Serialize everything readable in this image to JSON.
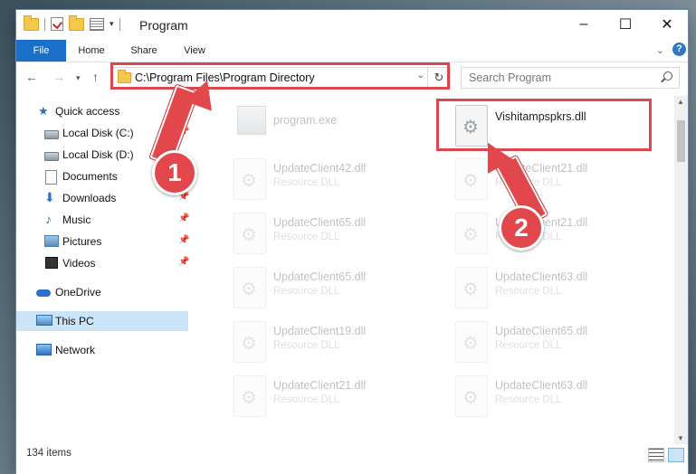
{
  "window": {
    "title": "Program",
    "controls": {
      "minimize": "–",
      "maximize": "☐",
      "close": "✕"
    }
  },
  "ribbon": {
    "tabs": [
      "File",
      "Home",
      "Share",
      "View"
    ]
  },
  "navigation": {
    "address": "C:\\Program Files\\Program Directory",
    "search_placeholder": "Search Program"
  },
  "sidebar": {
    "items": [
      {
        "label": "Quick access",
        "icon": "star-icon"
      },
      {
        "label": "Local Disk (C:)",
        "icon": "drive-icon",
        "pinned": true
      },
      {
        "label": "Local Disk (D:)",
        "icon": "drive-icon"
      },
      {
        "label": "Documents",
        "icon": "documents-icon",
        "pinned": true
      },
      {
        "label": "Downloads",
        "icon": "downloads-icon",
        "pinned": true
      },
      {
        "label": "Music",
        "icon": "music-icon",
        "pinned": true
      },
      {
        "label": "Pictures",
        "icon": "pictures-icon",
        "pinned": true
      },
      {
        "label": "Videos",
        "icon": "videos-icon",
        "pinned": true
      },
      {
        "label": "OneDrive",
        "icon": "onedrive-icon"
      },
      {
        "label": "This PC",
        "icon": "this-pc-icon",
        "selected": true
      },
      {
        "label": "Network",
        "icon": "network-icon"
      }
    ]
  },
  "files": [
    {
      "name": "program.exe",
      "type": ""
    },
    {
      "name": "Vishitampspkrs.dll",
      "type": ""
    },
    {
      "name": "UpdateClient42.dll",
      "type": "Resource DLL"
    },
    {
      "name": "UpdateClient21.dll",
      "type": "Resource DLL"
    },
    {
      "name": "UpdateClient65.dll",
      "type": "Resource DLL"
    },
    {
      "name": "UpdateClient21.dll",
      "type": "Resource DLL"
    },
    {
      "name": "UpdateClient65.dll",
      "type": "Resource DLL"
    },
    {
      "name": "UpdateClient63.dll",
      "type": "Resource DLL"
    },
    {
      "name": "UpdateClient19.dll",
      "type": "Resource DLL"
    },
    {
      "name": "UpdateClient65.dll",
      "type": "Resource DLL"
    },
    {
      "name": "UpdateClient21.dll",
      "type": "Resource DLL"
    },
    {
      "name": "UpdateClient63.dll",
      "type": "Resource DLL"
    }
  ],
  "status": {
    "item_count": "134 items"
  },
  "annotations": {
    "step1": "1",
    "step2": "2",
    "color": "#e2474c"
  }
}
